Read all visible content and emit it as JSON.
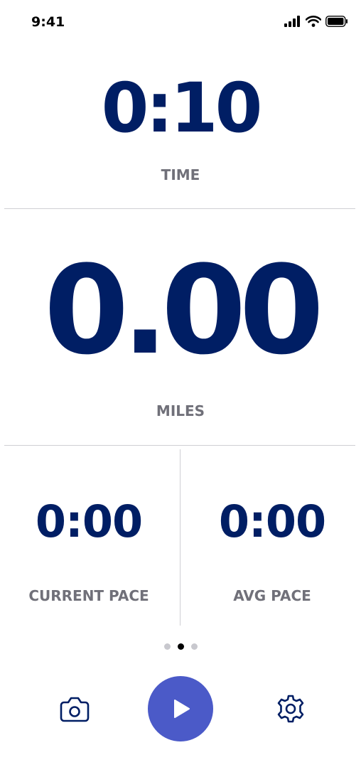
{
  "status_bar": {
    "time": "9:41",
    "icons": [
      "signal-icon",
      "wifi-icon",
      "battery-icon"
    ]
  },
  "time_metric": {
    "value": "0:10",
    "label": "TIME"
  },
  "distance_metric": {
    "value": "0.00",
    "label": "MILES"
  },
  "current_pace": {
    "value": "0:00",
    "label": "CURRENT PACE"
  },
  "avg_pace": {
    "value": "0:00",
    "label": "AVG PACE"
  },
  "pager": {
    "count": 3,
    "active_index": 1
  },
  "toolbar": {
    "left_icon": "camera-icon",
    "center_icon": "play-icon",
    "right_icon": "gear-icon"
  },
  "colors": {
    "value_text": "#001e64",
    "label_text": "#707079",
    "play_button": "#4b5ac8",
    "divider": "#cfcfd4"
  }
}
